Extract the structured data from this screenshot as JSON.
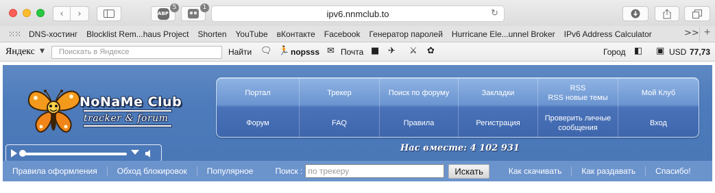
{
  "browser": {
    "address": "ipv6.nnmclub.to",
    "abp_badge_text": "ABP",
    "abp_badge_count": "5",
    "ghostery_badge_count": "1"
  },
  "favorites": {
    "items": [
      "DNS-хостинг",
      "Blocklist Rem...haus Project",
      "Shorten",
      "YouTube",
      "вКонтакте",
      "Facebook",
      "Генератор паролей",
      "Hurricane Ele...unnel Broker",
      "IPv6 Address Calculator"
    ],
    "more": ">>"
  },
  "yandex_bar": {
    "logo": "Яндекс",
    "search_placeholder": "Поискать в Яндексе",
    "find_label": "Найти",
    "user": "nopsss",
    "mail": "Почта",
    "city": "Город",
    "currency_label": "USD",
    "currency_value": "77,73"
  },
  "site": {
    "logo_title": "NoNaMe Club",
    "logo_subtitle": "tracker & forum",
    "menu": [
      [
        "Портал",
        "Трекер",
        "Поиск по форуму",
        "Закладки",
        "RSS\nRSS новые темы",
        "Мой Клуб"
      ],
      [
        "Форум",
        "FAQ",
        "Правила",
        "Регистрация",
        "Проверить личные\nсообщения",
        "Вход"
      ]
    ],
    "online_label": "Нас вместе: 4 102 931",
    "nav_left": [
      "Правила оформления",
      "Обход блокировок",
      "Популярное"
    ],
    "search_label": "Поиск :",
    "search_placeholder": "по трекеру",
    "search_button": "Искать",
    "nav_right": [
      "Как скачивать",
      "Как раздавать",
      "Спасибо!"
    ]
  },
  "colors": {
    "header_bg": "#4d7bbb",
    "nav_bg": "#6b93cc",
    "menu_top": "#8fb3e3",
    "menu_bottom": "#3d66ad"
  }
}
